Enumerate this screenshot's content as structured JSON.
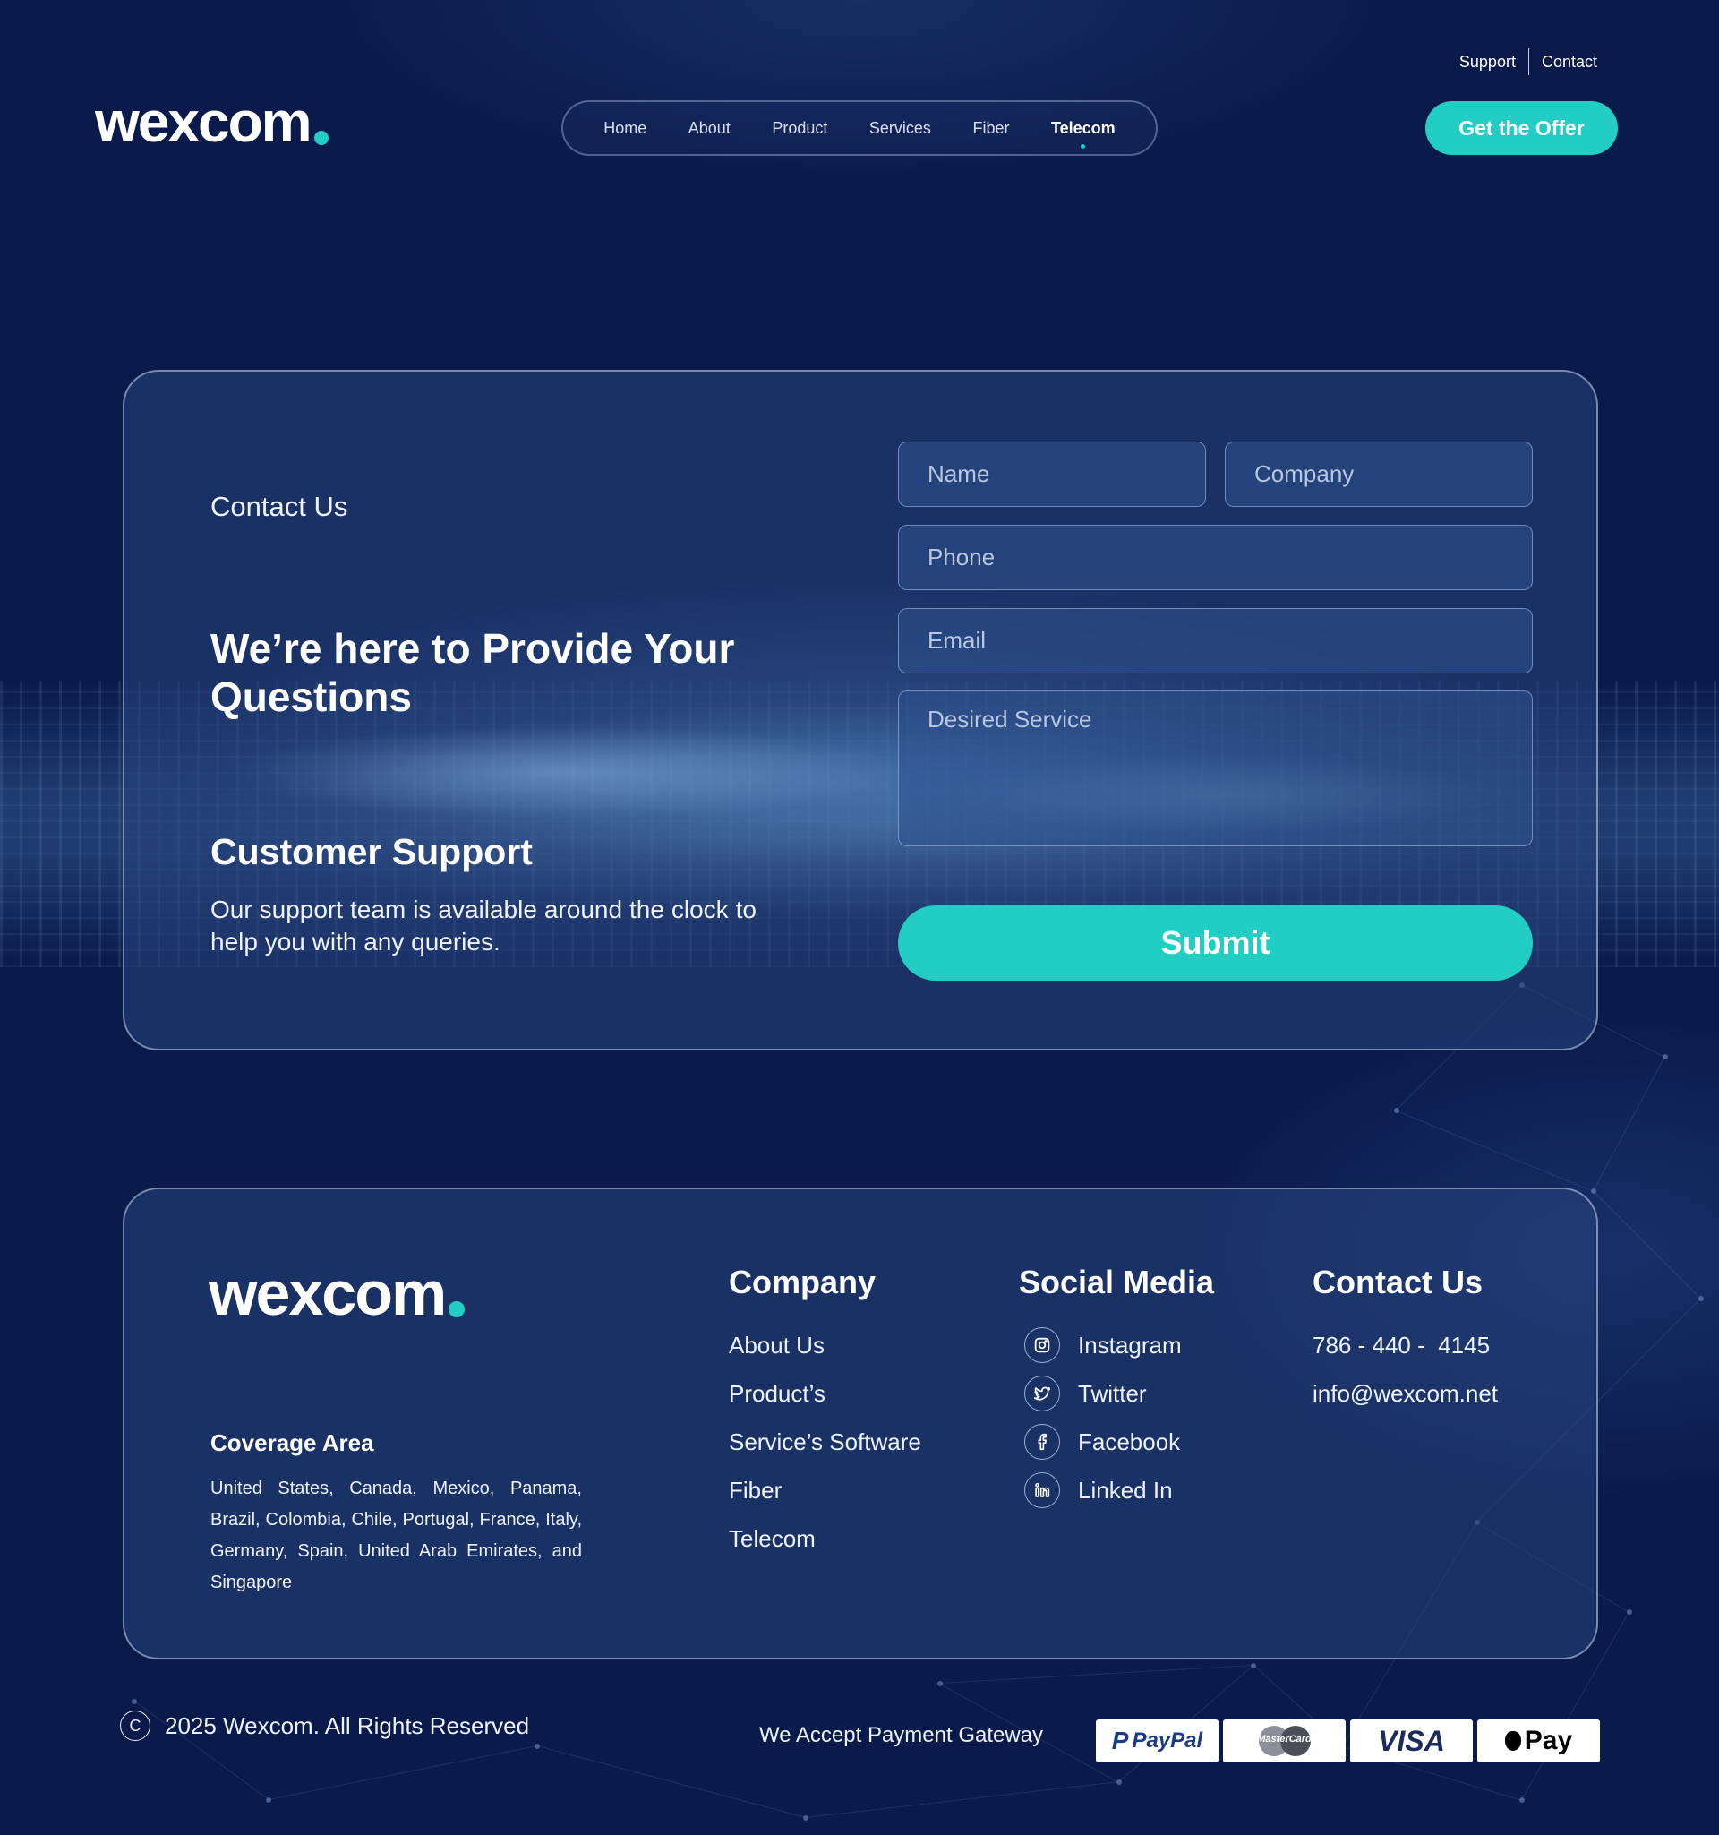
{
  "header": {
    "logo_text": "wexcom",
    "top_links": [
      "Support",
      "Contact"
    ],
    "nav": [
      "Home",
      "About",
      "Product",
      "Services",
      "Fiber",
      "Telecom"
    ],
    "active_nav": "Telecom",
    "cta_label": "Get the Offer"
  },
  "contact": {
    "label": "Contact Us",
    "heading": "We’re here to Provide Your Questions",
    "support_title": "Customer Support",
    "support_text": "Our support team is available around the clock to help you with any queries.",
    "form": {
      "name_placeholder": "Name",
      "company_placeholder": "Company",
      "phone_placeholder": "Phone",
      "email_placeholder": "Email",
      "service_placeholder": "Desired Service",
      "submit_label": "Submit"
    }
  },
  "footer": {
    "logo_text": "wexcom",
    "coverage_title": "Coverage Area",
    "coverage_text": "United States, Canada, Mexico, Panama, Brazil, Colombia, Chile, Portugal, France, Italy, Germany, Spain, United Arab Emirates, and Singapore",
    "company": {
      "title": "Company",
      "items": [
        "About Us",
        "Product’s",
        "Service’s Software",
        "Fiber",
        "Telecom"
      ]
    },
    "social": {
      "title": "Social Media",
      "items": [
        {
          "label": "Instagram",
          "icon": "instagram-icon"
        },
        {
          "label": "Twitter",
          "icon": "twitter-icon"
        },
        {
          "label": "Facebook",
          "icon": "facebook-icon"
        },
        {
          "label": "Linked In",
          "icon": "linkedin-icon"
        }
      ]
    },
    "contact": {
      "title": "Contact Us",
      "phone": "786 - 440 -  4145",
      "email": "info@wexcom.net"
    }
  },
  "bottom": {
    "copyright_symbol": "C",
    "copyright": "2025 Wexcom. All Rights Reserved",
    "payment_label": "We Accept Payment Gateway",
    "payments": [
      "PayPal",
      "MasterCard",
      "VISA",
      "Pay"
    ]
  },
  "colors": {
    "background": "#0a1a4a",
    "accent": "#22cdc4",
    "card": "#284680"
  }
}
